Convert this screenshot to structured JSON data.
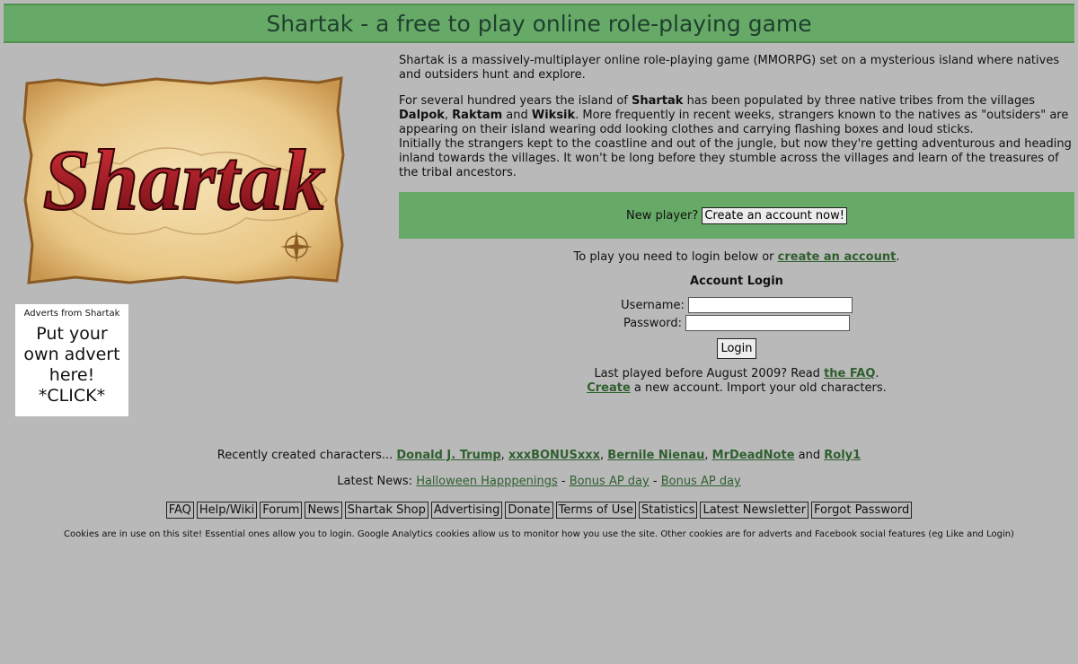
{
  "page": {
    "title": "Shartak - a free to play online role-playing game",
    "bg": "#b9b9b9",
    "accent": "#67aa67"
  },
  "logo": {
    "text": "Shartak"
  },
  "ad": {
    "label": "Adverts from Shartak",
    "text_line1": "Put your",
    "text_line2": "own advert",
    "text_line3": "here!",
    "text_line4": "*CLICK*"
  },
  "intro": {
    "p1": "Shartak is a massively-multiplayer online role-playing game (MMORPG) set on a mysterious island where natives and outsiders hunt and explore.",
    "p2_a": "For several hundred years the island of ",
    "p2_shartak": "Shartak",
    "p2_b": " has been populated by three native tribes from the villages ",
    "p2_dalpok": "Dalpok",
    "p2_c": ", ",
    "p2_raktam": "Raktam",
    "p2_d": " and ",
    "p2_wiksik": "Wiksik",
    "p2_e": ". More frequently in recent weeks, strangers known to the natives as \"outsiders\" are appearing on their island wearing odd looking clothes and carrying flashing boxes and loud sticks.",
    "p2_f": "Initially the strangers kept to the coastline and out of the jungle, but now they're getting adventurous and heading inland towards the villages. It won't be long before they stumble across the villages and learn of the treasures of the tribal ancestors."
  },
  "newplayer": {
    "label": "New player?",
    "button": "Create an account now!"
  },
  "login": {
    "intro_a": "To play you need to login below or ",
    "intro_link": "create an account",
    "intro_b": ".",
    "heading": "Account Login",
    "username_label": "Username:",
    "username_value": "",
    "password_label": "Password:",
    "password_value": "",
    "button": "Login",
    "faq_a": "Last played before August 2009? Read ",
    "faq_link": "the FAQ",
    "faq_b": ".",
    "create_link": "Create",
    "create_b": " a new account. Import your old characters."
  },
  "recent": {
    "label": "Recently created characters... ",
    "c1": "Donald J. Trump",
    "sep1": ", ",
    "c2": "xxxBONUSxxx",
    "sep2": ", ",
    "c3": "Bernile Nienau",
    "sep3": ", ",
    "c4": "MrDeadNote",
    "sep4": " and ",
    "c5": "Roly1"
  },
  "news": {
    "label": "Latest News: ",
    "n1": "Halloween Happpenings",
    "sep1": " - ",
    "n2": "Bonus AP day",
    "sep2": " - ",
    "n3": "Bonus AP day"
  },
  "nav": {
    "faq": "FAQ",
    "help": "Help/Wiki",
    "forum": "Forum",
    "news": "News",
    "shop": "Shartak Shop",
    "advertising": "Advertising",
    "donate": "Donate",
    "terms": "Terms of Use",
    "statistics": "Statistics",
    "newsletter": "Latest Newsletter",
    "forgot": "Forgot Password"
  },
  "cookies": "Cookies are in use on this site! Essential ones allow you to login. Google Analytics cookies allow us to monitor how you use the site. Other cookies are for adverts and Facebook social features (eg Like and Login)"
}
